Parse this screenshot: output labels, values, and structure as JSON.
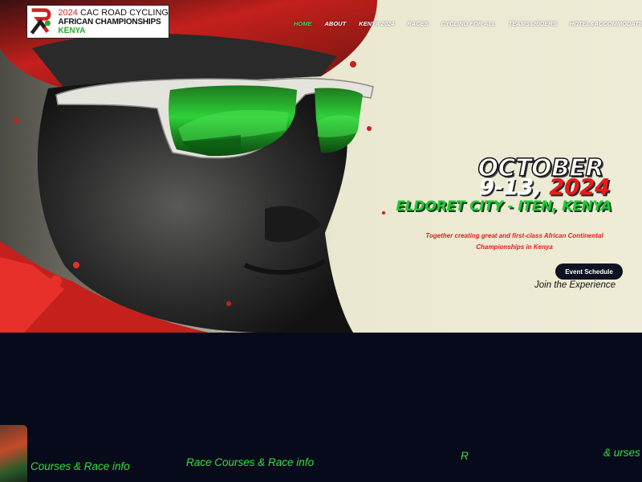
{
  "logo": {
    "year": "2024",
    "line1_rest": "CAC ROAD CYCLING",
    "line2": "AFRICAN CHAMPIONSHIPS",
    "line3": "KENYA"
  },
  "nav": {
    "items": [
      {
        "label": "HOME",
        "active": true
      },
      {
        "label": "ABOUT",
        "active": false
      },
      {
        "label": "KENYA 2024",
        "active": false
      },
      {
        "label": "RACES",
        "active": false
      },
      {
        "label": "CYCLING FOR ALL",
        "active": false
      },
      {
        "label": "TEAMS&RIDERS",
        "active": false
      },
      {
        "label": "HOTEL&ACCOMMODATION",
        "active": false
      }
    ]
  },
  "hero": {
    "month": "OCTOBER",
    "days": "9-13,",
    "year": "2024",
    "location": "ELDORET CITY - ITEN, KENYA",
    "tagline": "Together creating great and first-class African Continental Championships in Kenya",
    "cta_label": "Event Schedule",
    "join_text": "Join the Experience"
  },
  "carousel": {
    "label1": "Courses & Race info",
    "label2": "Race Courses & Race info",
    "label3": "R",
    "label4": "urses &"
  },
  "colors": {
    "accent_green": "#22c83a",
    "accent_red": "#e51c1c",
    "nav_active": "#3ae05a",
    "dark_bg": "#070a1a"
  }
}
